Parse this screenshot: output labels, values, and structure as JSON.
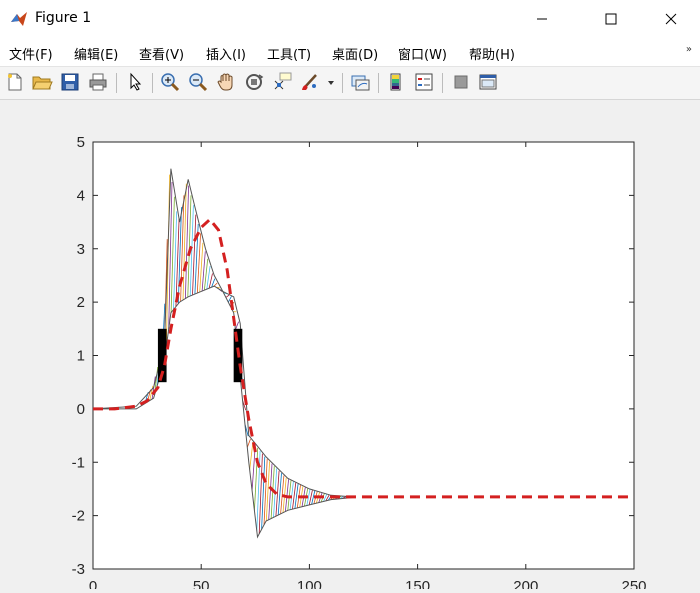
{
  "window": {
    "title": "Figure 1",
    "controls": {
      "minimize_icon": "minimize-icon",
      "maximize_icon": "maximize-icon",
      "close_icon": "close-icon"
    }
  },
  "menu": {
    "items": [
      {
        "label": "文件(F)"
      },
      {
        "label": "编辑(E)"
      },
      {
        "label": "查看(V)"
      },
      {
        "label": "插入(I)"
      },
      {
        "label": "工具(T)"
      },
      {
        "label": "桌面(D)"
      },
      {
        "label": "窗口(W)"
      },
      {
        "label": "帮助(H)"
      }
    ],
    "expand_icon": "double-chevron-right-icon"
  },
  "toolbar": {
    "icons": [
      "new-file-icon",
      "open-folder-icon",
      "save-icon",
      "print-icon",
      "pointer-icon",
      "zoom-in-icon",
      "zoom-out-icon",
      "pan-hand-icon",
      "rotate-3d-icon",
      "data-cursor-icon",
      "brush-icon",
      "brush-dropdown-icon",
      "link-plot-icon",
      "colorbar-icon",
      "legend-icon",
      "hide-tools-icon",
      "dock-icon"
    ]
  },
  "chart_data": {
    "type": "line",
    "xlim": [
      0,
      250
    ],
    "ylim": [
      -3,
      5
    ],
    "xticks": [
      "0",
      "50",
      "100",
      "150",
      "200",
      "250"
    ],
    "yticks": [
      "5",
      "4",
      "3",
      "2",
      "1",
      "0",
      "-1",
      "-2",
      "-3"
    ],
    "grid": false,
    "series": [
      {
        "style": "red-dashed",
        "color": "#d42020",
        "x": [
          0,
          10,
          20,
          25,
          30,
          33,
          36,
          40,
          45,
          50,
          54,
          58,
          62,
          65,
          68,
          72,
          76,
          80,
          85,
          90,
          100,
          110,
          120,
          150,
          200,
          250
        ],
        "y": [
          0,
          0,
          0.05,
          0.15,
          0.4,
          0.8,
          1.5,
          2.3,
          3.0,
          3.4,
          3.55,
          3.35,
          2.6,
          1.7,
          0.8,
          -0.2,
          -1.0,
          -1.4,
          -1.6,
          -1.65,
          -1.65,
          -1.65,
          -1.65,
          -1.65,
          -1.65,
          -1.65
        ]
      },
      {
        "style": "envelope-upper",
        "color": "#555555",
        "x": [
          0,
          20,
          28,
          33,
          36,
          40,
          44,
          47,
          52,
          56,
          60,
          65,
          68,
          72,
          76,
          80,
          90,
          100,
          110,
          120
        ],
        "y": [
          0,
          0.05,
          0.4,
          1.2,
          4.5,
          3.5,
          4.3,
          3.8,
          3.0,
          2.5,
          2.2,
          2.1,
          1.6,
          -0.5,
          -0.7,
          -0.9,
          -1.3,
          -1.5,
          -1.62,
          -1.65
        ]
      },
      {
        "style": "envelope-lower",
        "color": "#555555",
        "x": [
          0,
          20,
          28,
          33,
          36,
          40,
          44,
          50,
          56,
          60,
          65,
          68,
          72,
          76,
          80,
          90,
          100,
          110,
          120
        ],
        "y": [
          0,
          0,
          0.2,
          0.9,
          1.8,
          2.0,
          2.1,
          2.2,
          2.3,
          2.2,
          1.8,
          0.6,
          -1.0,
          -2.4,
          -2.1,
          -1.9,
          -1.8,
          -1.7,
          -1.66
        ]
      }
    ],
    "obstacles": [
      {
        "x": [
          30,
          34
        ],
        "y": [
          0.5,
          1.5
        ],
        "color": "#000000"
      },
      {
        "x": [
          65,
          69
        ],
        "y": [
          0.5,
          1.5
        ],
        "color": "#000000"
      }
    ]
  }
}
